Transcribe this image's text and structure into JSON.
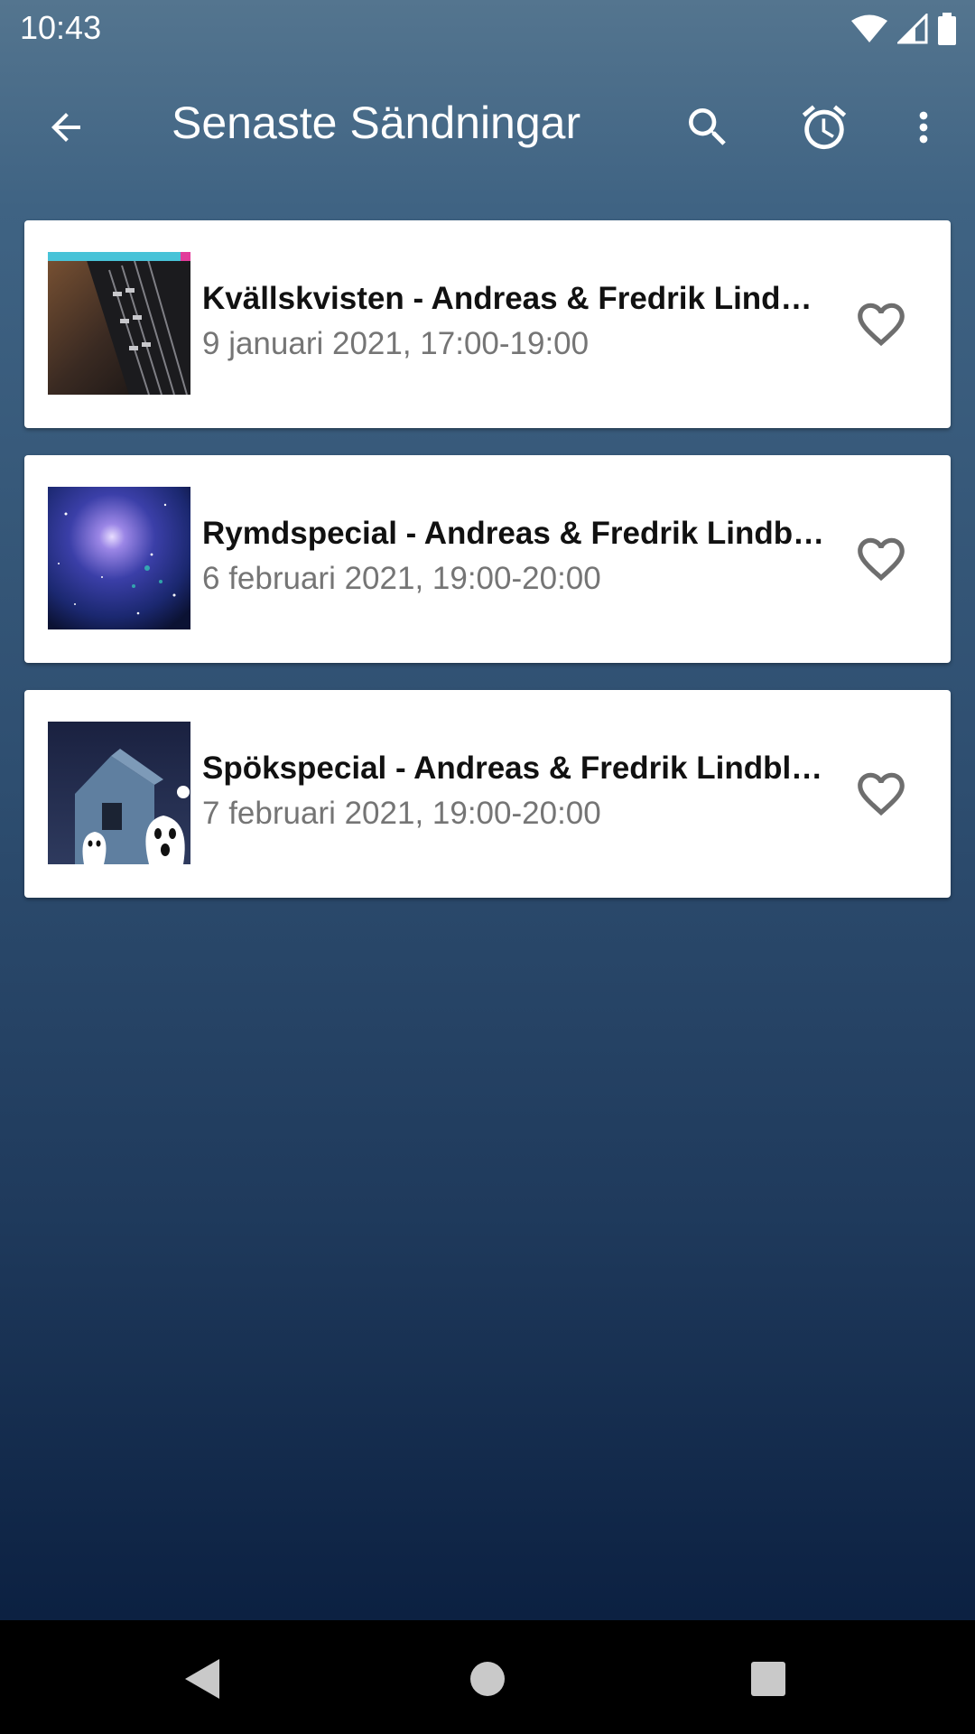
{
  "status_bar": {
    "time": "10:43"
  },
  "app_bar": {
    "title": "Senaste Sändningar"
  },
  "items": [
    {
      "title": "Kvällskvisten - Andreas & Fredrik Lind…",
      "date": "9 januari 2021, 17:00-19:00",
      "thumbnail": "guitar-photo"
    },
    {
      "title": "Rymdspecial - Andreas & Fredrik Lindb…",
      "date": "6 februari 2021, 19:00-20:00",
      "thumbnail": "space-nebula-photo"
    },
    {
      "title": "Spökspecial - Andreas & Fredrik Lindbl…",
      "date": "7 februari 2021, 19:00-20:00",
      "thumbnail": "haunted-house-ghosts-photo"
    }
  ],
  "icons": {
    "back": "arrow-back-icon",
    "search": "search-icon",
    "alarm": "alarm-clock-icon",
    "overflow": "more-vert-icon",
    "favorite": "heart-outline-icon"
  },
  "colors": {
    "title_text": "#111111",
    "date_text": "#757575",
    "card_bg": "#ffffff",
    "nav_bg": "#000000"
  }
}
